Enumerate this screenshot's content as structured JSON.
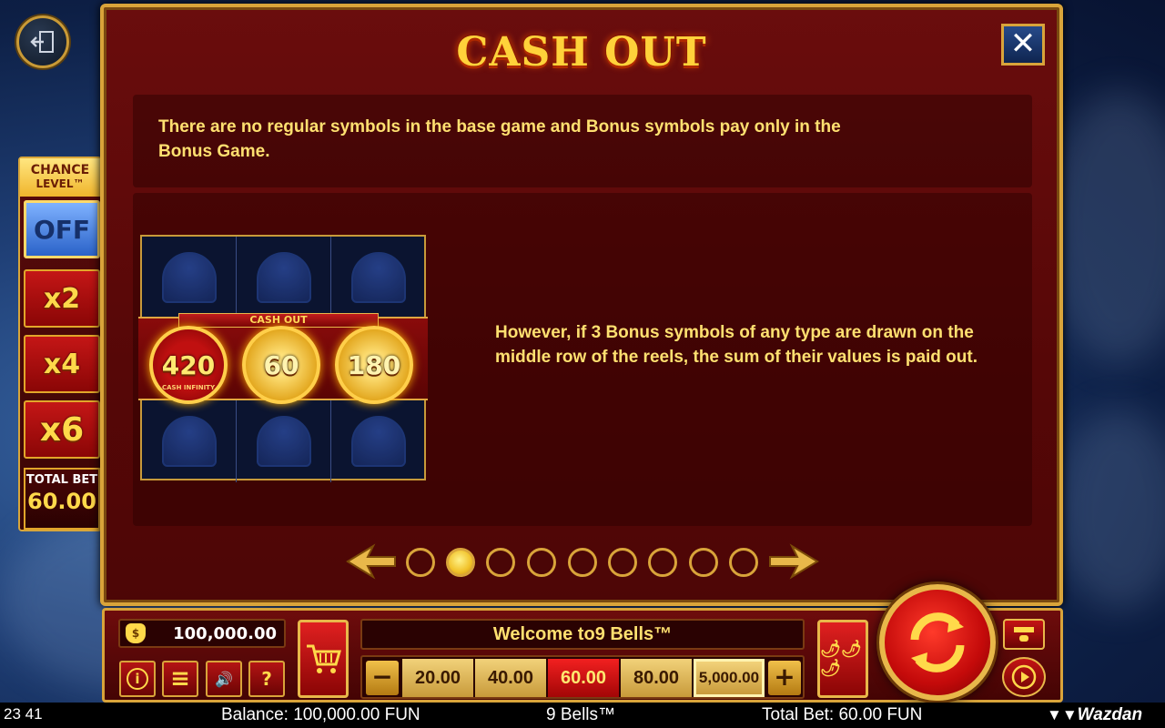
{
  "header": {
    "title": "CASH OUT",
    "close_glyph": "✕"
  },
  "chance_level": {
    "title_line1": "CHANCE",
    "title_line2": "LEVEL™",
    "off_label": "OFF",
    "multipliers": [
      "x2",
      "x4",
      "x6"
    ],
    "total_bet_label": "TOTAL BET",
    "total_bet_value": "60.00"
  },
  "content": {
    "intro_text": "There are no regular symbols in the base game and Bonus symbols pay only in the Bonus Game.",
    "description_text": "However, if 3 Bonus symbols of any type are drawn on the middle row of the reels, the sum of their values is paid out.",
    "illustration": {
      "banner": "CASH OUT",
      "coins": [
        "420",
        "60",
        "180"
      ],
      "red_coin_caption": "CASH INFINITY"
    }
  },
  "pagination": {
    "total_pages": 9,
    "active_page": 2
  },
  "controls": {
    "balance": "100,000.00",
    "message": "Welcome to9 Bells™",
    "bet_minus": "−",
    "bet_plus": "+",
    "bet_options": [
      "20.00",
      "40.00",
      "60.00",
      "80.00",
      "5,000.00"
    ],
    "selected_bet": "60.00",
    "info_glyph": "i",
    "menu_glyph": "≡",
    "sound_glyph": "🔊",
    "help_glyph": "?",
    "pepper_glyph": "🌶🌶🌶"
  },
  "status_bar": {
    "time": "23 41",
    "balance": "Balance: 100,000.00 FUN",
    "game_name": "9 Bells™",
    "total_bet": "Total Bet: 60.00 FUN",
    "brand": "Wazdan"
  },
  "colors": {
    "gold": "#d9a43a",
    "text_yellow": "#ffe070",
    "modal_red": "#5a0808",
    "selected_bet": "#d41010"
  }
}
